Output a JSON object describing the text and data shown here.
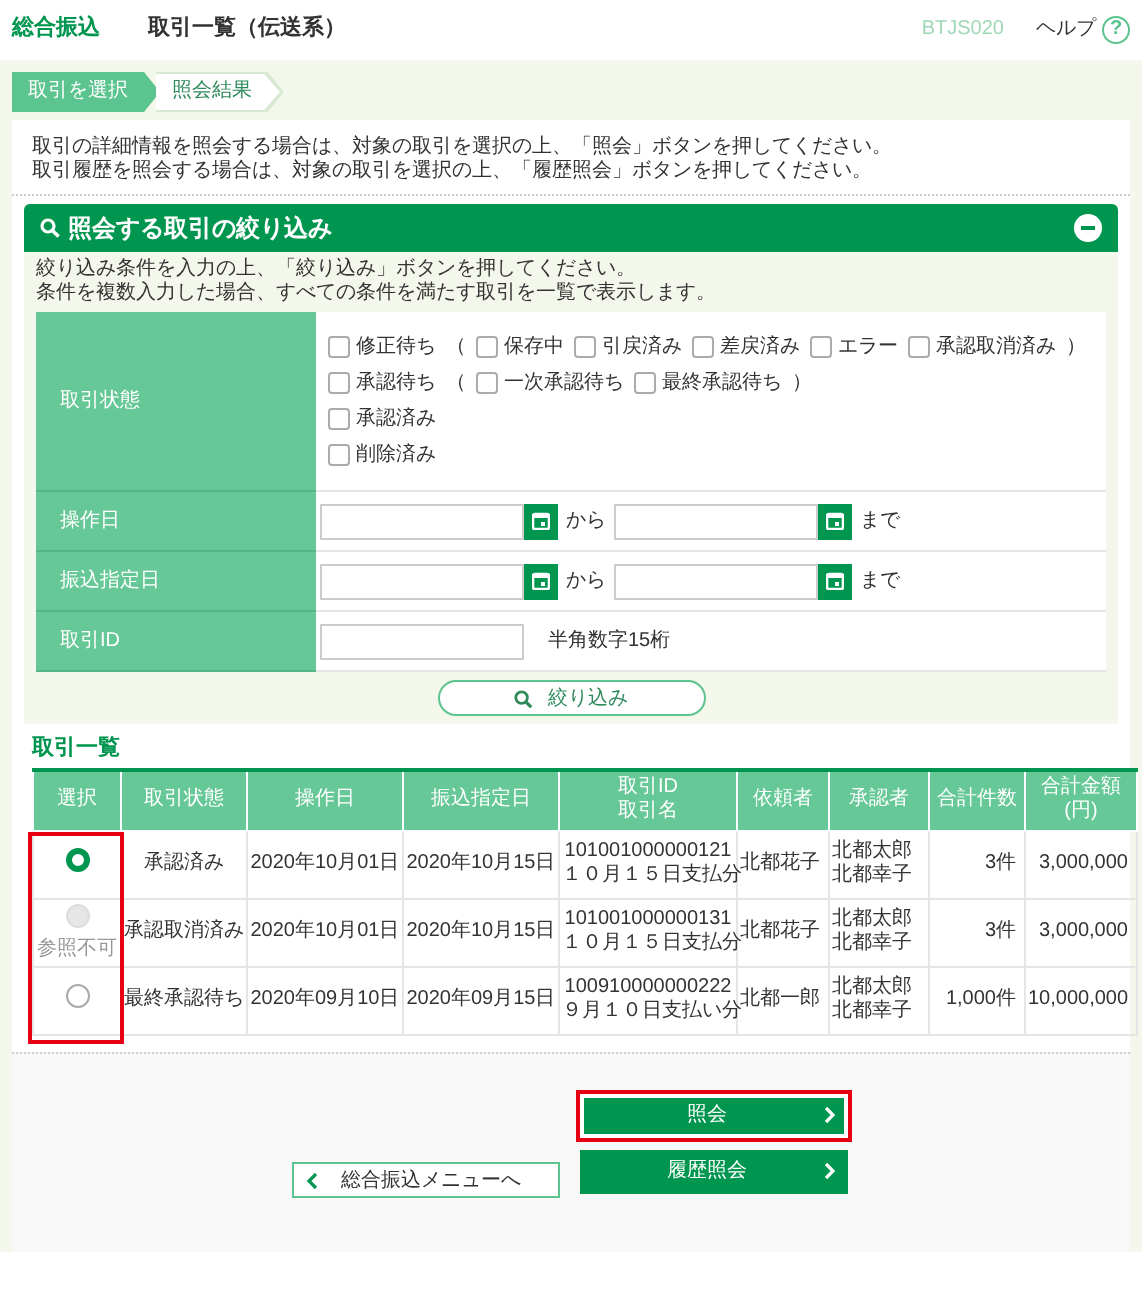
{
  "header": {
    "section": "総合振込",
    "title": "取引一覧（伝送系）",
    "screen_id": "BTJS020",
    "help": "ヘルプ",
    "help_mark": "?"
  },
  "steps": [
    {
      "label": "取引を選択",
      "selected": true
    },
    {
      "label": "照会結果",
      "selected": false
    }
  ],
  "instructions": [
    "取引の詳細情報を照会する場合は、対象の取引を選択の上、「照会」ボタンを押してください。",
    "取引履歴を照会する場合は、対象の取引を選択の上、「履歴照会」ボタンを押してください。"
  ],
  "filter": {
    "title": "照会する取引の絞り込み",
    "expanded": true,
    "description": [
      "絞り込み条件を入力の上、「絞り込み」ボタンを押してください。",
      "条件を複数入力した場合、すべての条件を満たす取引を一覧で表示します。"
    ],
    "rows": [
      {
        "kind": "status",
        "label": "取引状態",
        "lines": [
          [
            {
              "kind": "checkbox",
              "label": "修正待ち",
              "checked": false
            },
            {
              "kind": "text",
              "text": "（"
            },
            {
              "kind": "checkbox",
              "label": "保存中",
              "checked": false
            },
            {
              "kind": "checkbox",
              "label": "引戻済み",
              "checked": false
            },
            {
              "kind": "checkbox",
              "label": "差戻済み",
              "checked": false
            },
            {
              "kind": "checkbox",
              "label": "エラー",
              "checked": false
            },
            {
              "kind": "checkbox",
              "label": "承認取消済み",
              "checked": false
            },
            {
              "kind": "text",
              "text": "）"
            }
          ],
          [
            {
              "kind": "checkbox",
              "label": "承認待ち",
              "checked": false
            },
            {
              "kind": "text",
              "text": "（"
            },
            {
              "kind": "checkbox",
              "label": "一次承認待ち",
              "checked": false
            },
            {
              "kind": "checkbox",
              "label": "最終承認待ち",
              "checked": false
            },
            {
              "kind": "text",
              "text": "）"
            }
          ],
          [
            {
              "kind": "checkbox",
              "label": "承認済み",
              "checked": false
            }
          ],
          [
            {
              "kind": "checkbox",
              "label": "削除済み",
              "checked": false
            }
          ]
        ]
      },
      {
        "kind": "daterange",
        "label": "操作日",
        "from": "から",
        "to": "まで"
      },
      {
        "kind": "daterange",
        "label": "振込指定日",
        "from": "から",
        "to": "まで"
      },
      {
        "kind": "id",
        "label": "取引ID",
        "hint": "半角数字15桁"
      }
    ],
    "button": "絞り込み"
  },
  "table": {
    "title": "取引一覧",
    "highlight_select_column": true,
    "columns": [
      "選択",
      "取引状態",
      "操作日",
      "振込指定日",
      "取引ID\n取引名",
      "依頼者",
      "承認者",
      "合計件数",
      "合計金額\n(円)"
    ],
    "rows": [
      {
        "selected": true,
        "disabled": false,
        "status": "承認済み",
        "operation_date": "2020年10月01日",
        "transfer_date": "2020年10月15日",
        "id": "101001000000121",
        "name": "１０月１５日支払分",
        "requester": "北都花子",
        "approvers": [
          "北都太郎",
          "北都幸子"
        ],
        "count": "3件",
        "amount": "3,000,000"
      },
      {
        "selected": false,
        "disabled": true,
        "note": "参照不可",
        "status": "承認取消済み",
        "operation_date": "2020年10月01日",
        "transfer_date": "2020年10月15日",
        "id": "101001000000131",
        "name": "１０月１５日支払分",
        "requester": "北都花子",
        "approvers": [
          "北都太郎",
          "北都幸子"
        ],
        "count": "3件",
        "amount": "3,000,000"
      },
      {
        "selected": false,
        "disabled": false,
        "status": "最終承認待ち",
        "operation_date": "2020年09月10日",
        "transfer_date": "2020年09月15日",
        "id": "100910000000222",
        "name": "９月１０日支払い分",
        "requester": "北都一郎",
        "approvers": [
          "北都太郎",
          "北都幸子"
        ],
        "count": "1,000件",
        "amount": "10,000,000"
      }
    ]
  },
  "actions": {
    "back": "総合振込メニューへ",
    "buttons": [
      {
        "label": "照会",
        "highlighted": true
      },
      {
        "label": "履歴照会",
        "highlighted": false
      }
    ]
  }
}
